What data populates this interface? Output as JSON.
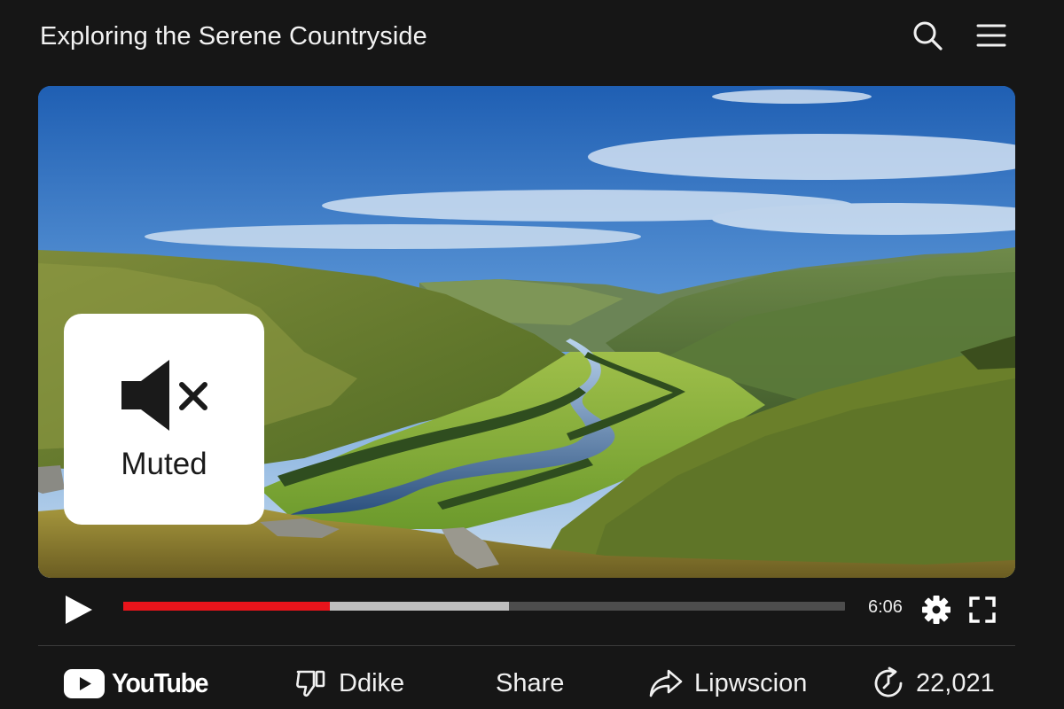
{
  "header": {
    "title": "Exploring the Serene Countryside"
  },
  "icons": {
    "search": "search-icon",
    "menu": "hamburger-menu-icon",
    "mute": "speaker-muted-icon",
    "play": "play-icon",
    "settings": "gear-icon",
    "fullscreen": "fullscreen-icon",
    "youtube": "youtube-logo-icon",
    "dislike": "thumbs-down-icon",
    "lip": "share-arrow-icon",
    "views": "replay-clock-icon"
  },
  "player": {
    "muted_label": "Muted",
    "time": "6:06",
    "played_fraction": 0.286,
    "buffered_fraction": 0.535
  },
  "bottom_bar": {
    "brand": "YouTube",
    "dislike_label": "Ddike",
    "share_label": "Share",
    "lip_label": "Lipwscion",
    "views_count": "22,021"
  },
  "colors": {
    "background": "#161616",
    "progress_played": "#e8141b",
    "progress_buffered": "#bdbdbd",
    "progress_track": "#4d4d4d",
    "youtube_red": "#ff0000"
  }
}
